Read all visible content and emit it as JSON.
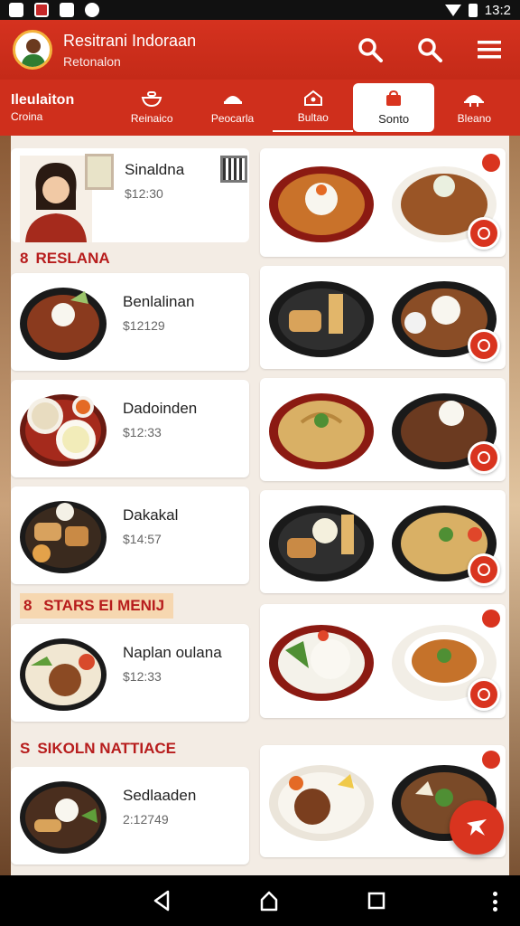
{
  "status_bar": {
    "time": "13:2"
  },
  "header": {
    "title": "Resitrani Indoraan",
    "subtitle": "Retonalon",
    "action_icons": [
      "search-icon",
      "search-icon",
      "menu-icon"
    ]
  },
  "tabs": [
    {
      "label": "Ileulaiton",
      "sub": "Croina",
      "icon": "none"
    },
    {
      "label": "Reinaico",
      "icon": "bowl-icon"
    },
    {
      "label": "Peocarla",
      "icon": "food-icon"
    },
    {
      "label": "Bultao",
      "icon": "house-icon"
    },
    {
      "label": "Sonto",
      "icon": "bag-icon",
      "active": true
    },
    {
      "label": "Bleano",
      "icon": "dish-cover-icon"
    }
  ],
  "profile": {
    "title": "Sinaldna",
    "price": "$12:30"
  },
  "sections": [
    {
      "title": "RESLANA",
      "icon": "8"
    },
    {
      "title": "STARS EI MENIJ",
      "icon": "8"
    },
    {
      "title": "SIKOLN NATTIACE",
      "icon": "S"
    }
  ],
  "menu_items": [
    {
      "title": "Benlalinan",
      "price": "$12129"
    },
    {
      "title": "Dadoinden",
      "price": "$12:33"
    },
    {
      "title": "Dakakal",
      "price": "$14:57"
    },
    {
      "title": "Naplan oulana",
      "price": "$12:33"
    },
    {
      "title": "Sedlaaden",
      "price": "2:12749"
    }
  ],
  "colors": {
    "brand_red": "#d5321f",
    "accent_gold": "#f4b33d",
    "background": "#f3ece4"
  }
}
